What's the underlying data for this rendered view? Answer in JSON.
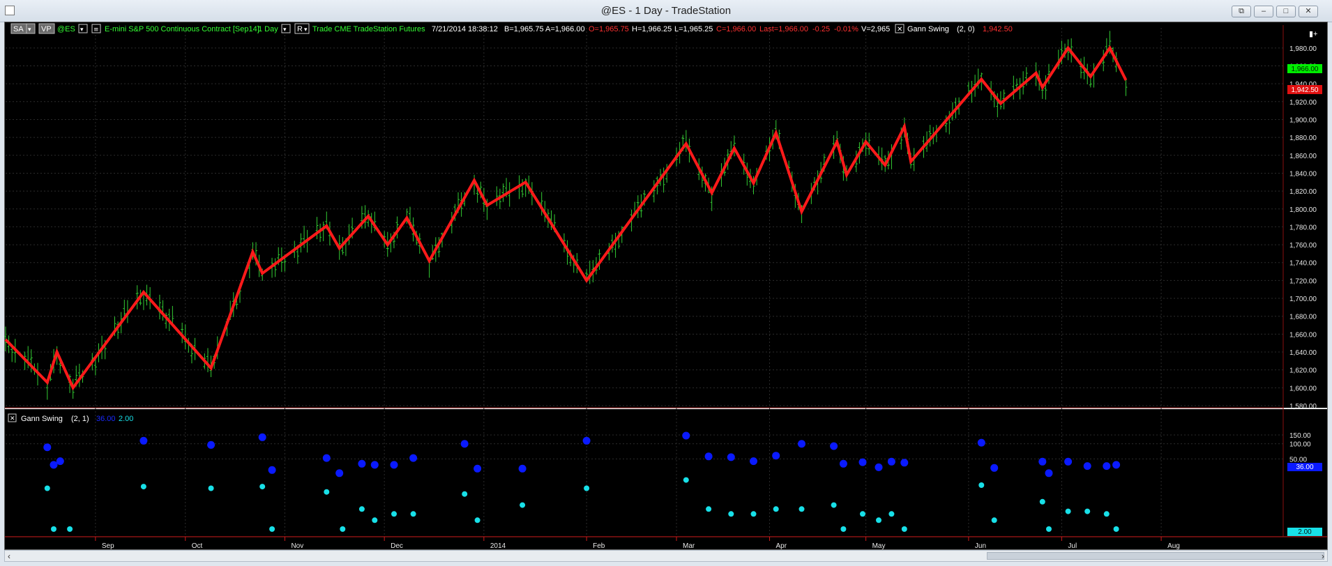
{
  "window": {
    "title": "@ES - 1 Day - TradeStation"
  },
  "header": {
    "sa_label": "SA",
    "vp_label": "VP",
    "symbol": "@ES",
    "description": "E-mini S&P 500 Continuous Contract [Sep14]",
    "interval": "1 Day",
    "r_label": "R",
    "data_source": "Trade  CME  TradeStation  Futures",
    "datetime": "7/21/2014  18:38:12",
    "bid": "B=1,965.75",
    "ask": "A=1,966.00",
    "open": "O=1,965.75",
    "high": "H=1,966.25",
    "low": "L=1,965.25",
    "close": "C=1,966.00",
    "last": "Last=1,966.00",
    "change": "-0.25",
    "change_pct": "-0.01%",
    "volume": "V=2,965",
    "indicator_name": "Gann Swing",
    "indicator_params": "(2,  0)",
    "indicator_value": "1,942.50"
  },
  "lower_header": {
    "indicator_name": "Gann Swing",
    "params": "(2,  1)",
    "value1": "36.00",
    "value2": "2.00"
  },
  "price_tags": {
    "last": "1,966.00",
    "swing": "1,942.50"
  },
  "lower_tags": {
    "v1": "36.00",
    "v2": "2.00"
  },
  "colors": {
    "bars": "#33cc33",
    "swing": "#ff1a1a",
    "dot_blue": "#0a1aff",
    "dot_cyan": "#18e0e8",
    "last_tag": "#00ee00",
    "swing_tag": "#e01010"
  },
  "chart_data": [
    {
      "type": "line",
      "name": "price",
      "x_axis": "date",
      "x_range": [
        "2013-08-06",
        "2014-09-08"
      ],
      "ylim": [
        1580,
        1990
      ],
      "y_ticks": [
        1580,
        1600,
        1620,
        1640,
        1660,
        1680,
        1700,
        1720,
        1740,
        1760,
        1780,
        1800,
        1820,
        1840,
        1860,
        1880,
        1900,
        1920,
        1940,
        1960,
        1980
      ],
      "x_tick_labels": [
        {
          "label": "Sep",
          "date": "2013-09-03"
        },
        {
          "label": "Oct",
          "date": "2013-10-01"
        },
        {
          "label": "Nov",
          "date": "2013-11-01"
        },
        {
          "label": "Dec",
          "date": "2013-12-02"
        },
        {
          "label": "2014",
          "date": "2014-01-02"
        },
        {
          "label": "Feb",
          "date": "2014-02-03"
        },
        {
          "label": "Mar",
          "date": "2014-03-03"
        },
        {
          "label": "Apr",
          "date": "2014-04-01"
        },
        {
          "label": "May",
          "date": "2014-05-01"
        },
        {
          "label": "Jun",
          "date": "2014-06-02"
        },
        {
          "label": "Jul",
          "date": "2014-07-01"
        },
        {
          "label": "Aug",
          "date": "2014-08-01"
        }
      ],
      "grid": true,
      "series": [
        {
          "kind": "swing_line",
          "indicator": "Gann Swing",
          "points": [
            [
              "2013-08-06",
              1654
            ],
            [
              "2013-08-19",
              1606
            ],
            [
              "2013-08-22",
              1640
            ],
            [
              "2013-08-27",
              1600
            ],
            [
              "2013-09-18",
              1707
            ],
            [
              "2013-10-09",
              1622
            ],
            [
              "2013-10-22",
              1752
            ],
            [
              "2013-10-25",
              1728
            ],
            [
              "2013-11-14",
              1781
            ],
            [
              "2013-11-18",
              1756
            ],
            [
              "2013-11-27",
              1792
            ],
            [
              "2013-12-03",
              1760
            ],
            [
              "2013-12-09",
              1790
            ],
            [
              "2013-12-16",
              1742
            ],
            [
              "2013-12-30",
              1832
            ],
            [
              "2014-01-03",
              1804
            ],
            [
              "2014-01-15",
              1830
            ],
            [
              "2014-02-03",
              1720
            ],
            [
              "2014-03-06",
              1873
            ],
            [
              "2014-03-14",
              1818
            ],
            [
              "2014-03-21",
              1868
            ],
            [
              "2014-03-27",
              1829
            ],
            [
              "2014-04-03",
              1885
            ],
            [
              "2014-04-11",
              1797
            ],
            [
              "2014-04-22",
              1875
            ],
            [
              "2014-04-25",
              1838
            ],
            [
              "2014-05-01",
              1875
            ],
            [
              "2014-05-07",
              1849
            ],
            [
              "2014-05-13",
              1892
            ],
            [
              "2014-05-15",
              1853
            ],
            [
              "2014-06-06",
              1945
            ],
            [
              "2014-06-12",
              1918
            ],
            [
              "2014-06-23",
              1952
            ],
            [
              "2014-06-25",
              1936
            ],
            [
              "2014-07-03",
              1980
            ],
            [
              "2014-07-10",
              1948
            ],
            [
              "2014-07-16",
              1980
            ],
            [
              "2014-07-21",
              1944
            ]
          ]
        }
      ]
    },
    {
      "type": "scatter",
      "name": "Gann Swing (2, 1)",
      "y_scale": "log",
      "ylim": [
        1.5,
        220
      ],
      "y_ticks": [
        50,
        100,
        150
      ],
      "series": [
        {
          "name": "36.00",
          "points": [
            [
              "2013-08-19",
              85
            ],
            [
              "2013-08-21",
              38
            ],
            [
              "2013-08-23",
              45
            ],
            [
              "2013-09-18",
              115
            ],
            [
              "2013-10-09",
              95
            ],
            [
              "2013-10-25",
              135
            ],
            [
              "2013-10-28",
              30
            ],
            [
              "2013-11-14",
              52
            ],
            [
              "2013-11-18",
              26
            ],
            [
              "2013-11-25",
              40
            ],
            [
              "2013-11-29",
              38
            ],
            [
              "2013-12-05",
              38
            ],
            [
              "2013-12-11",
              52
            ],
            [
              "2013-12-27",
              100
            ],
            [
              "2013-12-31",
              32
            ],
            [
              "2014-01-14",
              32
            ],
            [
              "2014-02-03",
              115
            ],
            [
              "2014-03-06",
              145
            ],
            [
              "2014-03-13",
              56
            ],
            [
              "2014-03-20",
              54
            ],
            [
              "2014-03-27",
              45
            ],
            [
              "2014-04-03",
              58
            ],
            [
              "2014-04-11",
              100
            ],
            [
              "2014-04-21",
              90
            ],
            [
              "2014-04-24",
              40
            ],
            [
              "2014-04-30",
              43
            ],
            [
              "2014-05-05",
              34
            ],
            [
              "2014-05-09",
              44
            ],
            [
              "2014-05-13",
              42
            ],
            [
              "2014-06-06",
              105
            ],
            [
              "2014-06-10",
              33
            ],
            [
              "2014-06-25",
              44
            ],
            [
              "2014-06-27",
              26
            ],
            [
              "2014-07-03",
              44
            ],
            [
              "2014-07-09",
              36
            ],
            [
              "2014-07-15",
              36
            ],
            [
              "2014-07-18",
              38
            ]
          ]
        },
        {
          "name": "2.00",
          "points": [
            [
              "2013-08-19",
              13
            ],
            [
              "2013-08-21",
              2
            ],
            [
              "2013-08-26",
              2
            ],
            [
              "2013-09-18",
              14
            ],
            [
              "2013-10-09",
              13
            ],
            [
              "2013-10-25",
              14
            ],
            [
              "2013-10-28",
              2
            ],
            [
              "2013-11-14",
              11
            ],
            [
              "2013-11-19",
              2
            ],
            [
              "2013-11-25",
              5
            ],
            [
              "2013-11-29",
              3
            ],
            [
              "2013-12-05",
              4
            ],
            [
              "2013-12-11",
              4
            ],
            [
              "2013-12-27",
              10
            ],
            [
              "2013-12-31",
              3
            ],
            [
              "2014-01-14",
              6
            ],
            [
              "2014-02-03",
              13
            ],
            [
              "2014-03-06",
              19
            ],
            [
              "2014-03-13",
              5
            ],
            [
              "2014-03-20",
              4
            ],
            [
              "2014-03-27",
              4
            ],
            [
              "2014-04-03",
              5
            ],
            [
              "2014-04-11",
              5
            ],
            [
              "2014-04-21",
              6
            ],
            [
              "2014-04-24",
              2
            ],
            [
              "2014-04-30",
              4
            ],
            [
              "2014-05-05",
              3
            ],
            [
              "2014-05-09",
              4
            ],
            [
              "2014-05-13",
              2
            ],
            [
              "2014-06-06",
              15
            ],
            [
              "2014-06-10",
              3
            ],
            [
              "2014-06-25",
              7
            ],
            [
              "2014-06-27",
              2
            ],
            [
              "2014-07-03",
              4.5
            ],
            [
              "2014-07-09",
              4.5
            ],
            [
              "2014-07-15",
              4
            ],
            [
              "2014-07-18",
              2
            ]
          ]
        }
      ]
    }
  ]
}
